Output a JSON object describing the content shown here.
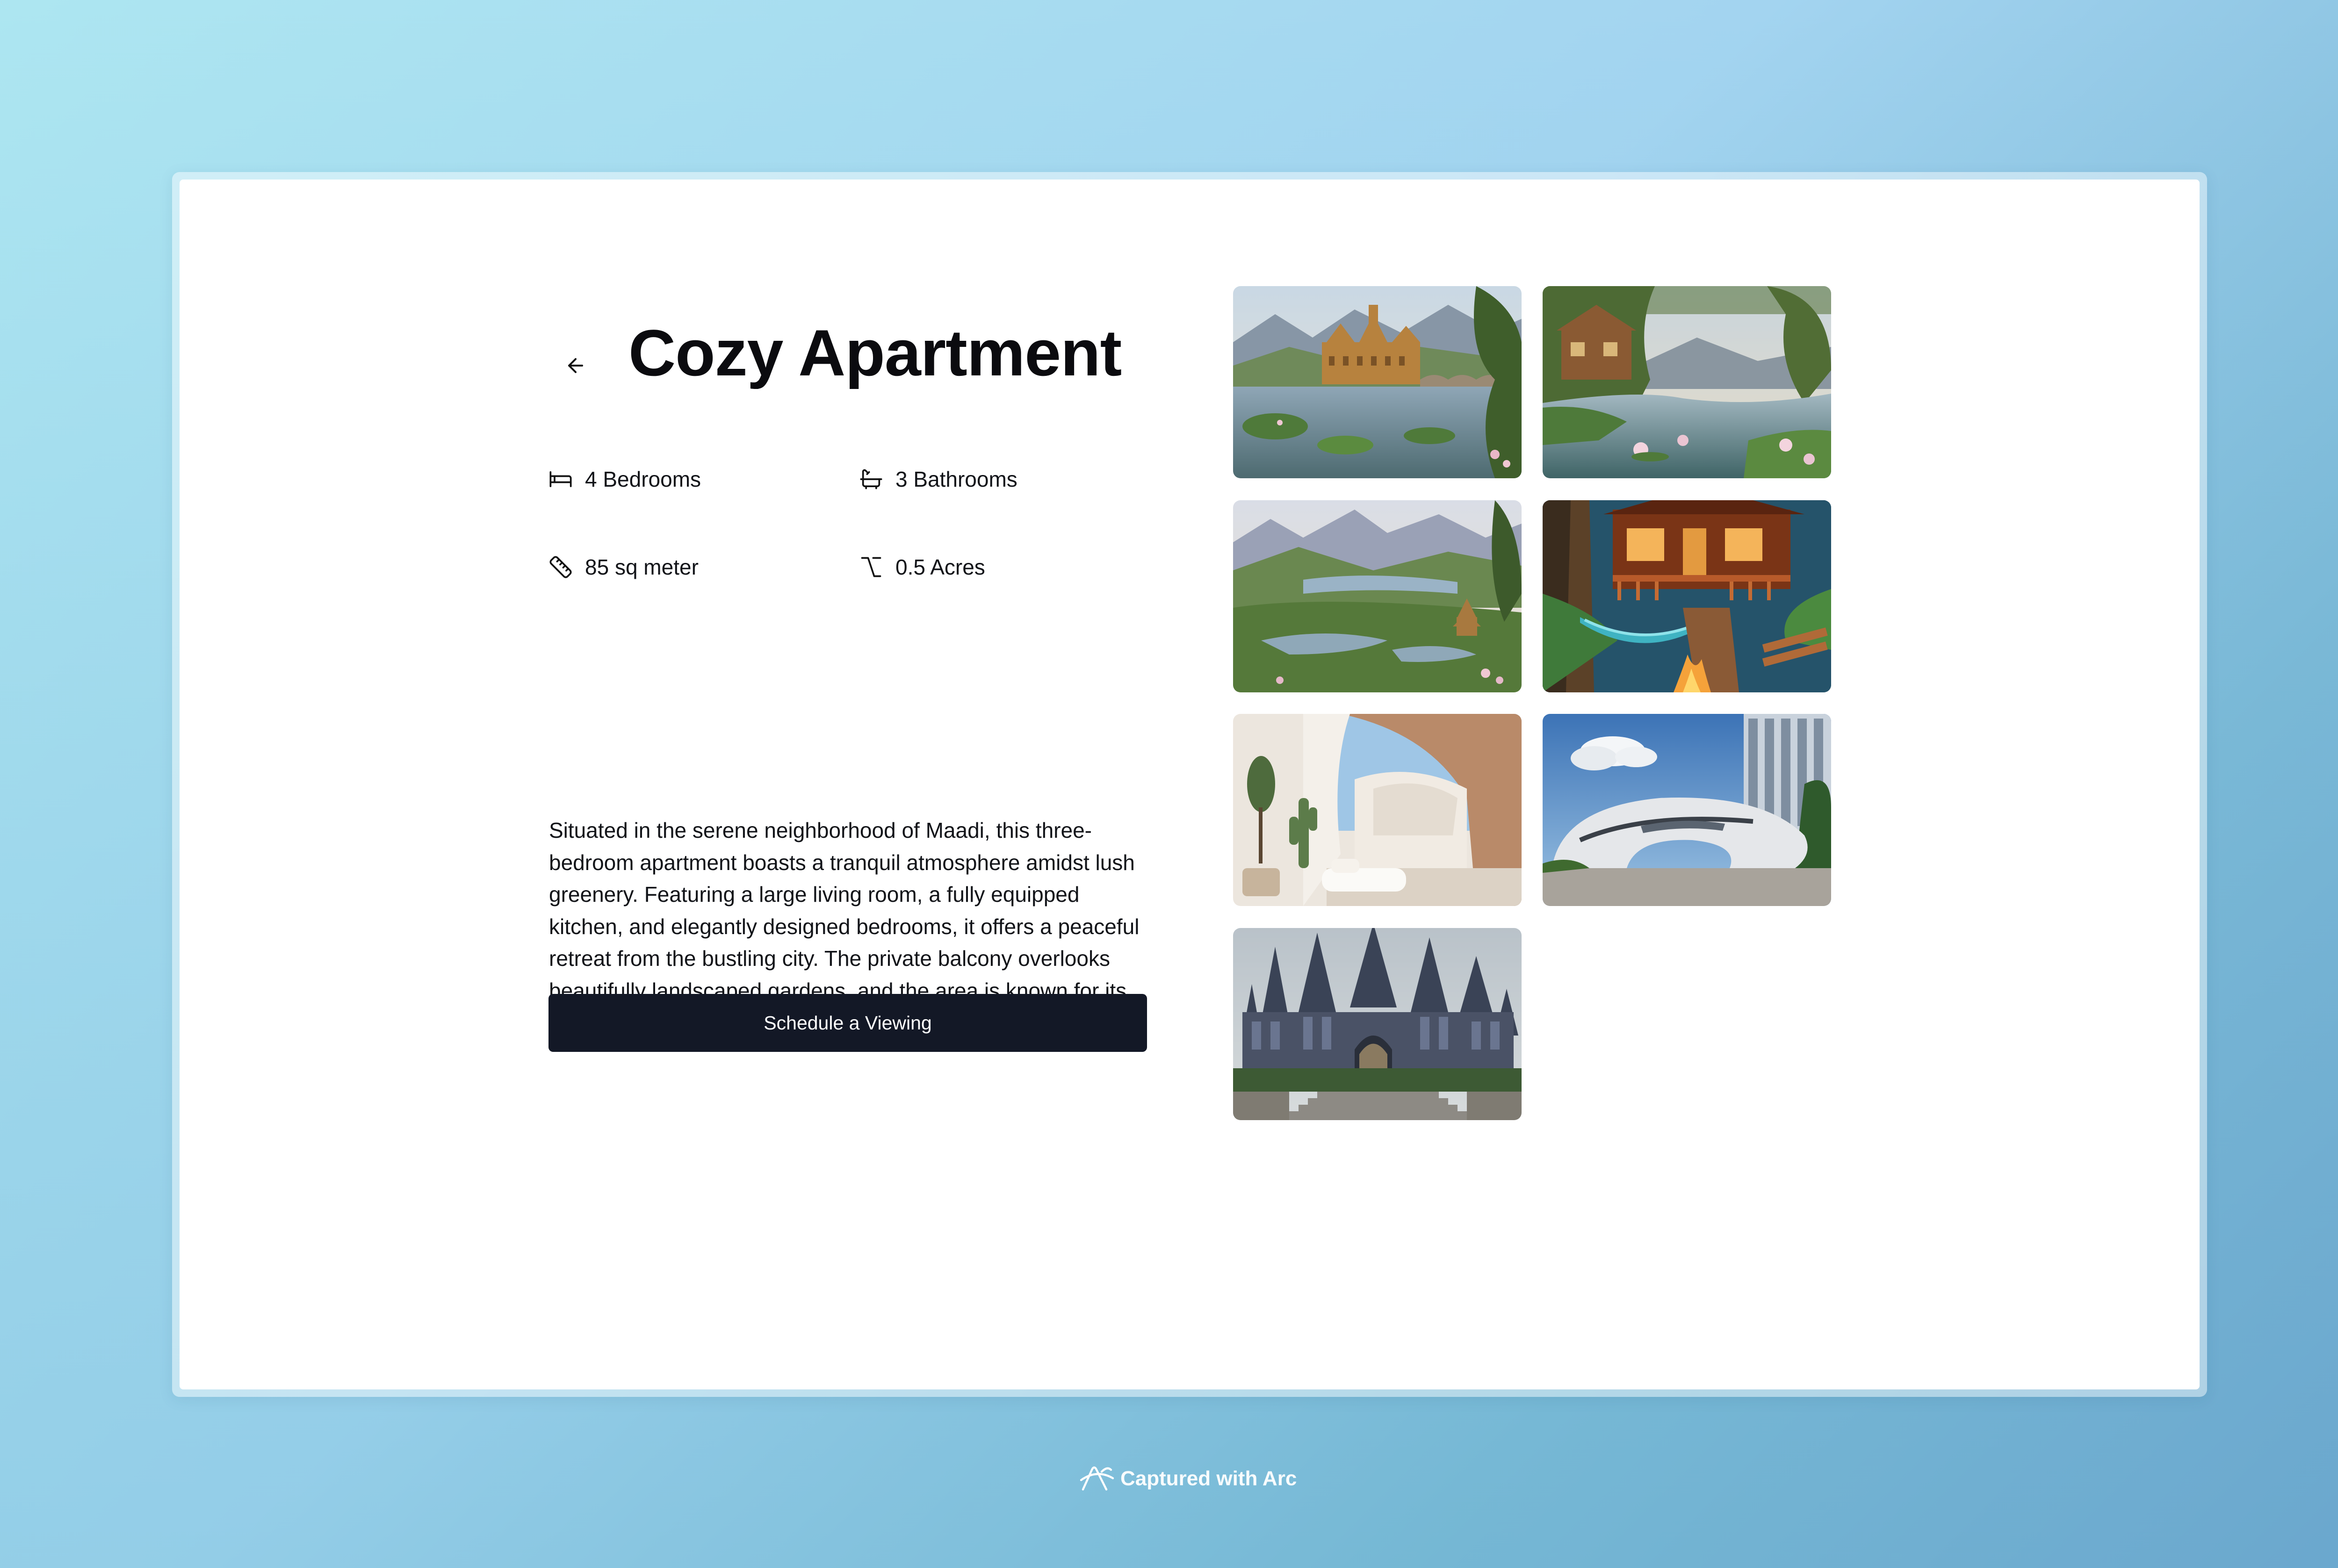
{
  "listing": {
    "title": "Cozy Apartment",
    "back_icon": "arrow-left-icon",
    "features": [
      {
        "icon": "bed-icon",
        "label": "4 Bedrooms"
      },
      {
        "icon": "bathtub-icon",
        "label": "3 Bathrooms"
      },
      {
        "icon": "ruler-icon",
        "label": "85 sq meter"
      },
      {
        "icon": "option-key-icon",
        "label": "0.5 Acres"
      }
    ],
    "description": "Situated in the serene neighborhood of Maadi, this three-bedroom apartment boasts a tranquil atmosphere amidst lush greenery. Featuring a large living room, a fully equipped kitchen, and elegantly designed bedrooms, it offers a peaceful retreat from the bustling city. The private balcony overlooks beautifully landscaped gardens, and the area is known for its excellent schools, cafes, and international community.",
    "cta_label": "Schedule a Viewing"
  },
  "gallery": [
    {
      "name": "gallery-image-palace-by-lake"
    },
    {
      "name": "gallery-image-riverside-cabins"
    },
    {
      "name": "gallery-image-mountain-lake-valley"
    },
    {
      "name": "gallery-image-cabin-porch-hammock"
    },
    {
      "name": "gallery-image-arched-stone-interior"
    },
    {
      "name": "gallery-image-futuristic-building"
    },
    {
      "name": "gallery-image-gothic-castle"
    }
  ],
  "watermark": {
    "label": "Captured with Arc",
    "icon": "arc-logo-icon"
  },
  "colors": {
    "button_bg": "#131826",
    "text": "#111318",
    "title": "#0b0b0f"
  }
}
